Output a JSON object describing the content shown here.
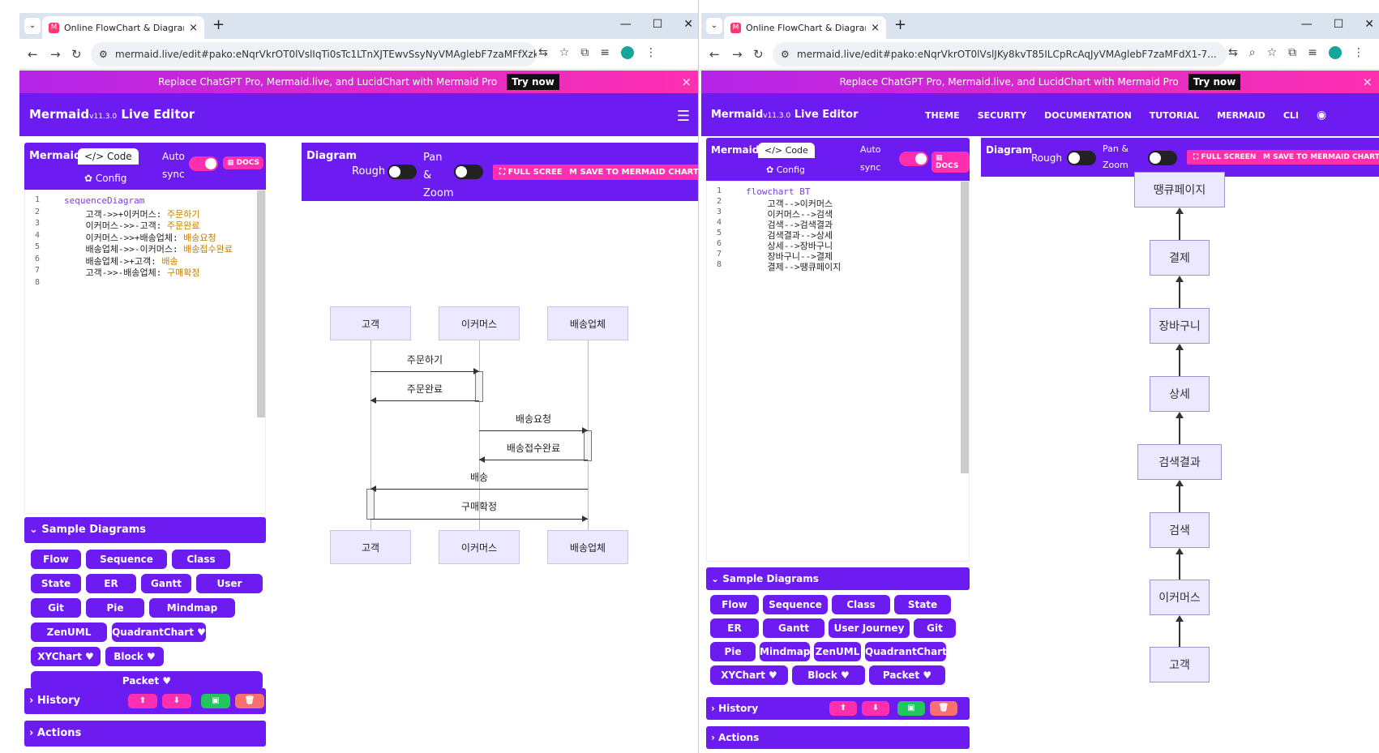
{
  "browser": {
    "tab_title": "Online FlowChart & Diagrams",
    "tab_close": "×",
    "new_tab": "+",
    "window_controls": [
      "—",
      "☐",
      "✕"
    ],
    "url_left": "mermaid.live/edit#pako:eNqrVkrOT0lVslIqTi0sTc1LTnXJTEwvSsyNyVMAglebF7zaMFfXzk77z...",
    "url_right": "mermaid.live/edit#pako:eNqrVkrOT0lVslJKy8kvT85ILCpRcAqJyVMAglebF7zaMFdX1-7..."
  },
  "promo": {
    "text": "Replace ChatGPT Pro, Mermaid.live, and LucidChart with Mermaid Pro",
    "button": "Try now",
    "close": "×"
  },
  "header": {
    "brand": "Mermaid",
    "version": "v11.3.0",
    "brand_suffix": "Live Editor",
    "menu": [
      "THEME",
      "SECURITY",
      "DOCUMENTATION",
      "TUTORIAL",
      "MERMAID",
      "CLI"
    ]
  },
  "editor_panel": {
    "title": "Mermaid",
    "code_tab": "</> Code",
    "config_tab": "Config",
    "auto_sync": "Auto sync",
    "docs": "DOCS"
  },
  "diagram_panel": {
    "title": "Diagram",
    "rough": "Rough",
    "pan_zoom": "Pan & Zoom",
    "full_screen": "FULL SCREEN",
    "save": "SAVE TO MERMAID CHART"
  },
  "left_code": [
    "sequenceDiagram",
    "    고객->>+이커머스: 주문하기",
    "    이커머스->>-고객: 주문완료",
    "    이커머스->>+배송업체: 배송요청",
    "    배송업체->>-이커머스: 배송접수완료",
    "    배송업체->+고객: 배송",
    "    고객->>-배송업체: 구매확정",
    ""
  ],
  "right_code": [
    "flowchart BT",
    "    고객-->이커머스",
    "    이커머스-->검색",
    "    검색-->검색결과",
    "    검색결과-->상세",
    "    상세-->장바구니",
    "    장바구니-->결제",
    "    결제-->땡큐페이지"
  ],
  "samples": {
    "title": "Sample Diagrams",
    "items": [
      "Flow",
      "Sequence",
      "Class",
      "State",
      "ER",
      "Gantt",
      "User Journey",
      "Git",
      "Pie",
      "Mindmap",
      "ZenUML",
      "QuadrantChart ♥",
      "XYChart ♥",
      "Block ♥",
      "Packet ♥"
    ]
  },
  "history": {
    "title": "History"
  },
  "actions": {
    "title": "Actions"
  },
  "sequence": {
    "actors": [
      "고객",
      "이커머스",
      "배송업체"
    ],
    "messages": [
      "주문하기",
      "주문완료",
      "배송요청",
      "배송접수완료",
      "배송",
      "구매확정"
    ]
  },
  "flowchart": {
    "nodes": [
      "땡큐페이지",
      "결제",
      "장바구니",
      "상세",
      "검색결과",
      "검색",
      "이커머스",
      "고객"
    ]
  },
  "colors": {
    "brand": "#6c1bf0",
    "accent": "#ff2fb0"
  }
}
